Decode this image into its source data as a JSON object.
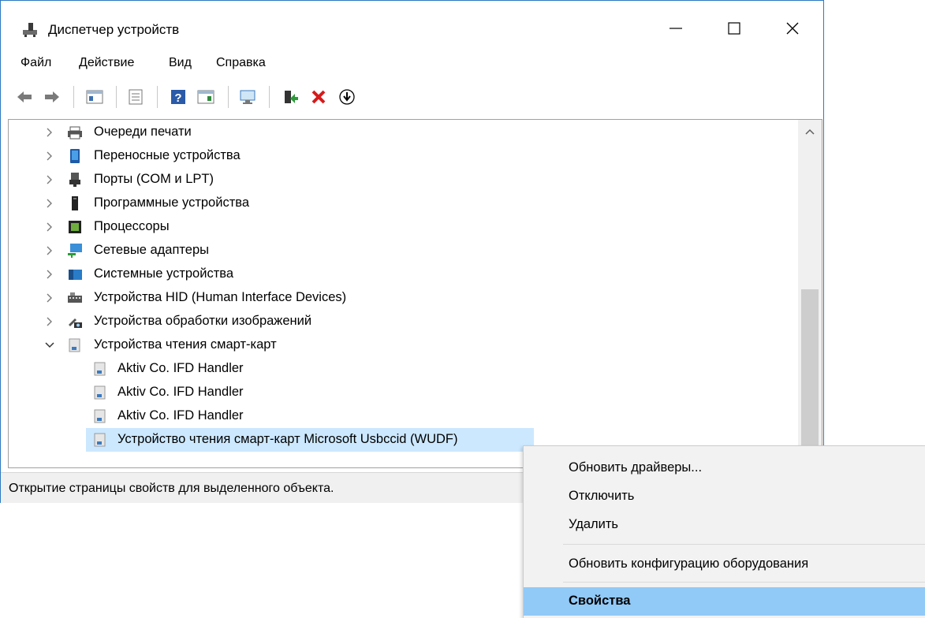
{
  "window": {
    "title": "Диспетчер устройств"
  },
  "menu": {
    "file": "Файл",
    "action": "Действие",
    "view": "Вид",
    "help": "Справка"
  },
  "toolbar": {
    "icons": [
      "back-arrow-icon",
      "forward-arrow-icon",
      "properties-icon",
      "print-icon",
      "help-icon",
      "view-icon",
      "monitor-scan-icon",
      "update-driver-icon",
      "uninstall-x-icon",
      "download-icon"
    ]
  },
  "tree": {
    "items": [
      {
        "label": "Очереди печати",
        "expanded": false,
        "icon": "printer-icon"
      },
      {
        "label": "Переносные устройства",
        "expanded": false,
        "icon": "portable-device-icon"
      },
      {
        "label": "Порты (COM и LPT)",
        "expanded": false,
        "icon": "port-icon"
      },
      {
        "label": "Программные устройства",
        "expanded": false,
        "icon": "software-device-icon"
      },
      {
        "label": "Процессоры",
        "expanded": false,
        "icon": "cpu-icon"
      },
      {
        "label": "Сетевые адаптеры",
        "expanded": false,
        "icon": "network-adapter-icon"
      },
      {
        "label": "Системные устройства",
        "expanded": false,
        "icon": "system-device-icon"
      },
      {
        "label": "Устройства HID (Human Interface Devices)",
        "expanded": false,
        "icon": "hid-icon"
      },
      {
        "label": "Устройства обработки изображений",
        "expanded": false,
        "icon": "camera-icon"
      },
      {
        "label": "Устройства чтения смарт-карт",
        "expanded": true,
        "icon": "smartcard-reader-icon"
      }
    ],
    "children": [
      {
        "label": "Aktiv Co. IFD Handler"
      },
      {
        "label": "Aktiv Co. IFD Handler"
      },
      {
        "label": "Aktiv Co. IFD Handler"
      },
      {
        "label": "Устройство чтения смарт-карт Microsoft Usbccid (WUDF)",
        "selected": true
      }
    ]
  },
  "status": {
    "text": "Открытие страницы свойств для выделенного объекта."
  },
  "context_menu": {
    "update_drivers": "Обновить драйверы...",
    "disable": "Отключить",
    "remove": "Удалить",
    "scan_hardware": "Обновить конфигурацию оборудования",
    "properties": "Свойства"
  },
  "colors": {
    "selection": "#cce8ff",
    "menu_highlight": "#91c9f7",
    "window_border": "#2b79c2"
  }
}
